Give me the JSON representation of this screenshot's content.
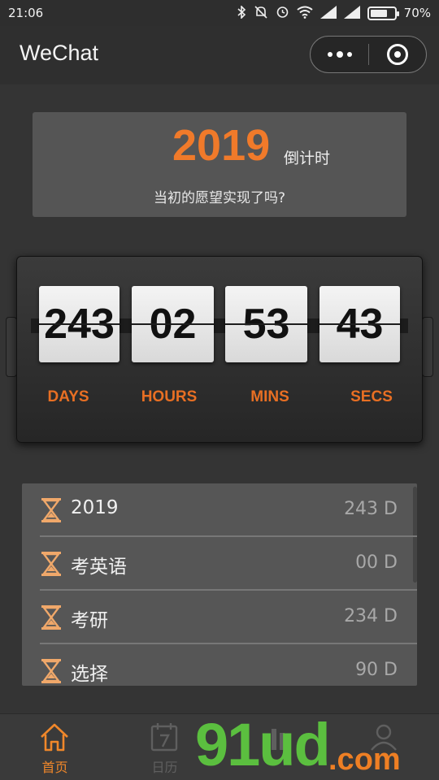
{
  "status_bar": {
    "time": "21:06",
    "battery": "70%",
    "battery_level": 0.7,
    "icons": [
      "bluetooth-icon",
      "mute-icon",
      "alarm-icon",
      "wifi-icon",
      "signal-icon",
      "signal-icon",
      "battery-icon"
    ]
  },
  "navbar": {
    "title": "WeChat"
  },
  "header": {
    "year": "2019",
    "suffix": "倒计时",
    "question": "当初的愿望实现了吗?"
  },
  "countdown": {
    "days": "243",
    "hours": "02",
    "mins": "53",
    "secs": "43",
    "labels": {
      "days": "DAYS",
      "hours": "HOURS",
      "mins": "MINS",
      "secs": "SECS"
    }
  },
  "list": {
    "items": [
      {
        "name": "2019",
        "days": "243 D"
      },
      {
        "name": "考英语",
        "days": "00 D"
      },
      {
        "name": "考研",
        "days": "234 D"
      },
      {
        "name": "选择",
        "days": "90 D"
      }
    ]
  },
  "tabbar": {
    "tabs": [
      {
        "label": "首页",
        "icon": "home-icon"
      },
      {
        "label": "日历",
        "icon": "calendar-icon"
      },
      {
        "label": "",
        "icon": "stats-icon"
      },
      {
        "label": "",
        "icon": "profile-icon"
      }
    ]
  },
  "watermark": {
    "main": "91ud",
    "suffix": ".com"
  },
  "colors": {
    "accent": "#f07a2a",
    "background": "#343434",
    "card": "#555555"
  }
}
